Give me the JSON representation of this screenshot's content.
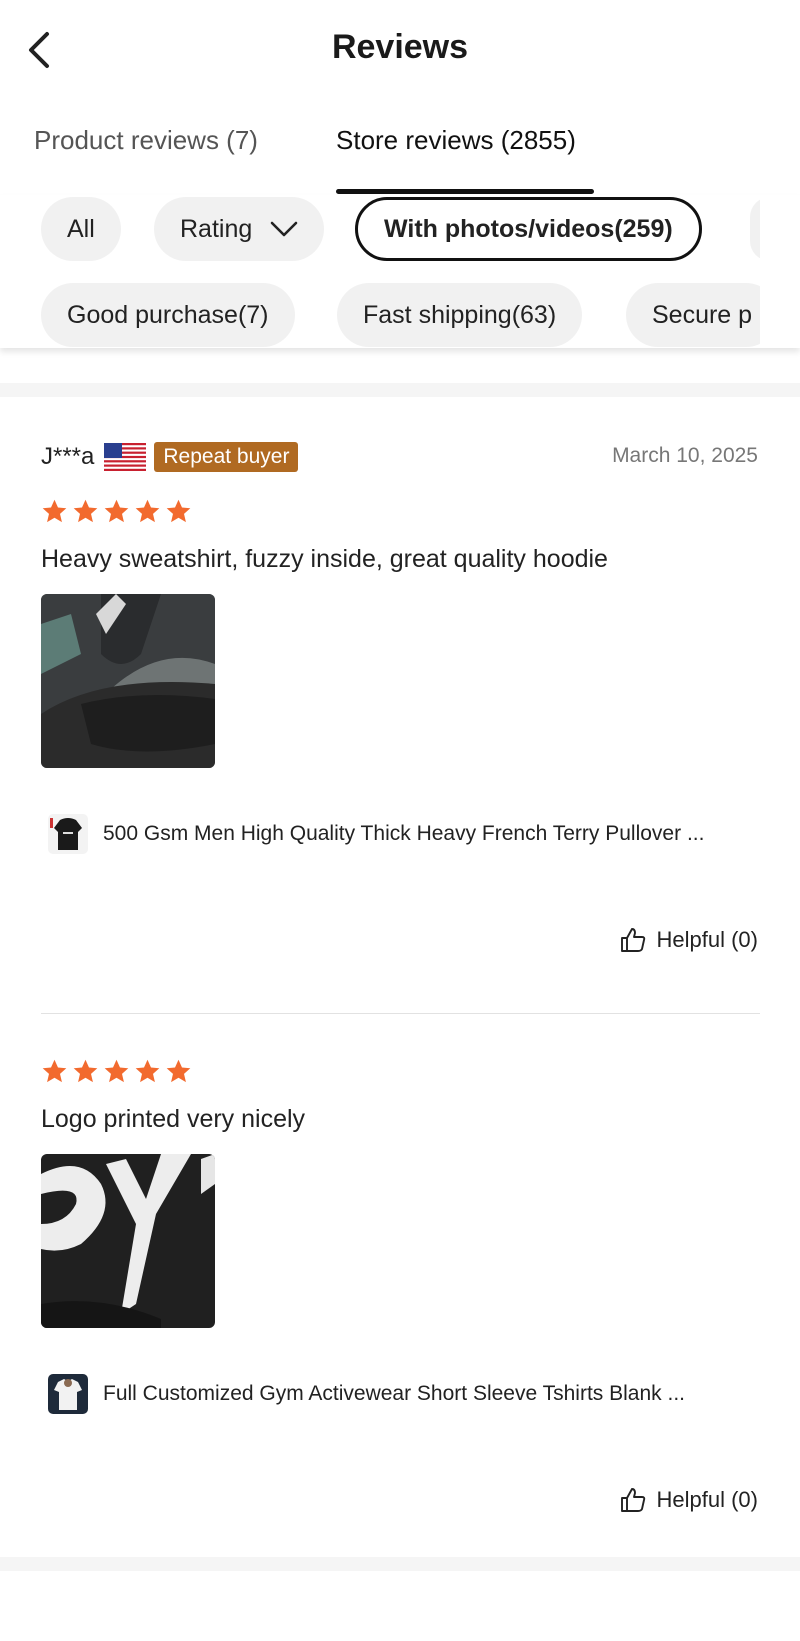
{
  "header": {
    "title": "Reviews"
  },
  "tabs": [
    {
      "label": "Product reviews (7)"
    },
    {
      "label": "Store reviews (2855)"
    }
  ],
  "filters": {
    "row1": [
      {
        "label": "All"
      },
      {
        "label": "Rating"
      },
      {
        "label": "With photos/videos(259)"
      }
    ],
    "row2": [
      {
        "label": "Good purchase(7)"
      },
      {
        "label": "Fast shipping(63)"
      },
      {
        "label": "Secure p"
      }
    ]
  },
  "reviews": [
    {
      "user": "J***a",
      "badge": "Repeat buyer",
      "date": "March 10, 2025",
      "rating": 5,
      "text": "Heavy sweatshirt, fuzzy inside, great quality hoodie",
      "product": "500 Gsm Men High Quality Thick Heavy French Terry Pullover ...",
      "helpful": "Helpful (0)"
    },
    {
      "rating": 5,
      "text": "Logo printed very nicely",
      "product": "Full Customized Gym Activewear Short Sleeve Tshirts Blank ...",
      "helpful": "Helpful (0)"
    }
  ],
  "colors": {
    "star": "#f26a2e",
    "badge": "#b06a22",
    "accent": "#111111"
  }
}
